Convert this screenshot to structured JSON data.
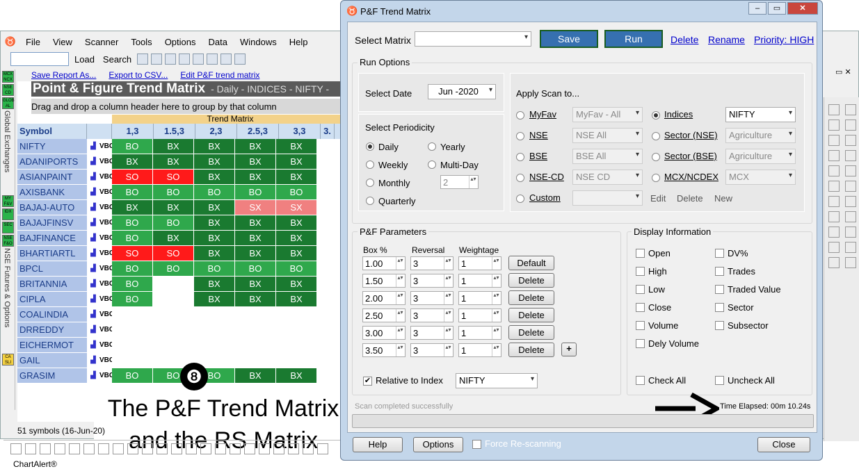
{
  "main": {
    "menu": [
      "File",
      "View",
      "Scanner",
      "Tools",
      "Options",
      "Data",
      "Windows",
      "Help"
    ],
    "toolbar": {
      "load": "Load",
      "search": "Search"
    },
    "left_strip": [
      "MCX NCX",
      "NSE CD",
      "GLOB AL",
      "MY F&V",
      "IDX",
      "SEC",
      "NSE F&O",
      "CA SLI"
    ],
    "left_vertical": [
      "Global Exchanges",
      "NSE Futures & Options"
    ],
    "links": [
      "Save Report As...",
      "Export to CSV...",
      "Edit P&F trend matrix"
    ],
    "title": "Point & Figure Trend Matrix",
    "subtitle": "- Daily - INDICES - NIFTY -",
    "group_hint": "Drag and drop a column header here to group by that column",
    "trend_matrix_label": "Trend Matrix",
    "symbol_header": "Symbol",
    "col_headers": [
      "1,3",
      "1.5,3",
      "2,3",
      "2.5,3",
      "3,3",
      "3."
    ],
    "rows": [
      {
        "sym": "NIFTY",
        "cells": [
          "BO",
          "BX",
          "BX",
          "BX",
          "BX"
        ]
      },
      {
        "sym": "ADANIPORTS",
        "cells": [
          "BX",
          "BX",
          "BX",
          "BX",
          "BX"
        ]
      },
      {
        "sym": "ASIANPAINT",
        "cells": [
          "SO",
          "SO",
          "BX",
          "BX",
          "BX"
        ]
      },
      {
        "sym": "AXISBANK",
        "cells": [
          "BO",
          "BO",
          "BO",
          "BO",
          "BO"
        ]
      },
      {
        "sym": "BAJAJ-AUTO",
        "cells": [
          "BX",
          "BX",
          "BX",
          "SX",
          "SX"
        ]
      },
      {
        "sym": "BAJAJFINSV",
        "cells": [
          "BO",
          "BO",
          "BX",
          "BX",
          "BX"
        ]
      },
      {
        "sym": "BAJFINANCE",
        "cells": [
          "BO",
          "BX",
          "BX",
          "BX",
          "BX"
        ]
      },
      {
        "sym": "BHARTIARTL",
        "cells": [
          "SO",
          "SO",
          "BX",
          "BX",
          "BX"
        ]
      },
      {
        "sym": "BPCL",
        "cells": [
          "BO",
          "BO",
          "BO",
          "BO",
          "BO"
        ]
      },
      {
        "sym": "BRITANNIA",
        "cells": [
          "BO",
          "",
          "BX",
          "BX",
          "BX"
        ]
      },
      {
        "sym": "CIPLA",
        "cells": [
          "BO",
          "",
          "BX",
          "BX",
          "BX"
        ]
      },
      {
        "sym": "COALINDIA",
        "cells": [
          "",
          "",
          "",
          "",
          ""
        ]
      },
      {
        "sym": "DRREDDY",
        "cells": [
          "",
          "",
          "",
          "",
          ""
        ]
      },
      {
        "sym": "EICHERMOT",
        "cells": [
          "",
          "",
          "",
          "",
          ""
        ]
      },
      {
        "sym": "GAIL",
        "cells": [
          "",
          "",
          "",
          "",
          ""
        ]
      },
      {
        "sym": "GRASIM",
        "cells": [
          "BO",
          "BO",
          "BO",
          "BX",
          "BX"
        ]
      }
    ],
    "vbc": "VBC",
    "overlay_badge": "❽",
    "overlay_line1": "The P&F Trend Matrix",
    "overlay_line2": "and the RS Matrix",
    "status": "51 symbols (16-Jun-20)",
    "brand": "ChartAlert®"
  },
  "dialog": {
    "title": "P&F Trend Matrix",
    "select_matrix_label": "Select Matrix",
    "select_matrix_value": "",
    "save": "Save",
    "run": "Run",
    "delete": "Delete",
    "rename": "Rename",
    "priority": "Priority: HIGH",
    "run_options": "Run Options",
    "select_date_label": "Select Date",
    "select_date_value": "Jun -2020",
    "select_periodicity": "Select Periodicity",
    "periodicity": {
      "daily": "Daily",
      "weekly": "Weekly",
      "monthly": "Monthly",
      "quarterly": "Quarterly",
      "yearly": "Yearly",
      "multiday": "Multi-Day",
      "multiday_value": "2"
    },
    "apply_scan": "Apply Scan to...",
    "scan_left": [
      {
        "label": "MyFav",
        "value": "MyFav - All"
      },
      {
        "label": "NSE",
        "value": "NSE All"
      },
      {
        "label": "BSE",
        "value": "BSE All"
      },
      {
        "label": "NSE-CD",
        "value": "NSE CD"
      },
      {
        "label": "Custom",
        "value": ""
      }
    ],
    "scan_right": [
      {
        "label": "Indices",
        "value": "NIFTY"
      },
      {
        "label": "Sector (NSE)",
        "value": "Agriculture"
      },
      {
        "label": "Sector (BSE)",
        "value": "Agriculture"
      },
      {
        "label": "MCX/NCDEX",
        "value": "MCX"
      }
    ],
    "custom_actions": [
      "Edit",
      "Delete",
      "New"
    ],
    "pf_params": "P&F Parameters",
    "param_headers": [
      "Box %",
      "Reversal",
      "Weightage"
    ],
    "params": [
      {
        "box": "1.00",
        "rev": "3",
        "wt": "1",
        "action": "Default"
      },
      {
        "box": "1.50",
        "rev": "3",
        "wt": "1",
        "action": "Delete"
      },
      {
        "box": "2.00",
        "rev": "3",
        "wt": "1",
        "action": "Delete"
      },
      {
        "box": "2.50",
        "rev": "3",
        "wt": "1",
        "action": "Delete"
      },
      {
        "box": "3.00",
        "rev": "3",
        "wt": "1",
        "action": "Delete"
      },
      {
        "box": "3.50",
        "rev": "3",
        "wt": "1",
        "action": "Delete"
      }
    ],
    "add": "+",
    "relative_label": "Relative to Index",
    "relative_value": "NIFTY",
    "display_info": "Display Information",
    "display_left": [
      "Open",
      "High",
      "Low",
      "Close",
      "Volume",
      "Dely Volume"
    ],
    "display_right": [
      "DV%",
      "Trades",
      "Traded Value",
      "Sector",
      "Subsector"
    ],
    "check_all": "Check All",
    "uncheck_all": "Uncheck All",
    "scan_status": "Scan completed successfully",
    "time_elapsed": "Time Elapsed: 00m 10.24s",
    "help": "Help",
    "options": "Options",
    "force_rescan": "Force Re-scanning",
    "close": "Close"
  },
  "colors": {
    "dark_green": "#1a7a30",
    "light_green": "#2fa84c",
    "red": "#ff1a1a",
    "pink": "#f08080",
    "run_blue": "#3670b0"
  }
}
